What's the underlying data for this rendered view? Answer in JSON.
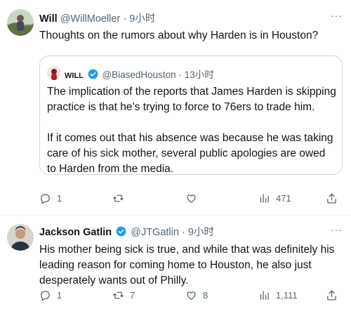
{
  "tweet1": {
    "name": "Will",
    "handle": "@WillMoeller",
    "separator": "·",
    "time": "9小时",
    "text": "Thoughts on the rumors about why Harden is in Houston?",
    "more": "···",
    "quote": {
      "name": "WILL",
      "handle": "@BiasedHouston",
      "separator": "·",
      "time": "13小时",
      "paragraph1": "The implication of the reports that James Harden is skipping practice is that he’s trying to force to 76ers to trade him.",
      "paragraph2": "If it comes out that his absence was because he was taking care of his sick mother, several public apologies are owed to Harden from the media."
    },
    "actions": {
      "replies": "1",
      "retweets": "",
      "likes": "",
      "views": "471"
    }
  },
  "tweet2": {
    "name": "Jackson Gatlin",
    "handle": "@JTGatlin",
    "separator": "·",
    "time": "9小时",
    "text": "His mother being sick is true, and while that was definitely his leading reason for coming home to Houston, he also just desperately wants out of Philly.",
    "more": "···",
    "actions": {
      "replies": "1",
      "retweets": "7",
      "likes": "8",
      "views": "1,111"
    }
  },
  "icons": {
    "reply": "reply-icon",
    "retweet": "retweet-icon",
    "like": "heart-icon",
    "views": "views-chart-icon",
    "share": "share-icon",
    "verified": "verified-badge-icon",
    "more": "more-dots-icon"
  },
  "colors": {
    "text": "#0f1419",
    "secondary": "#536471",
    "verified": "#1d9bf0",
    "border": "#cfd9de"
  }
}
